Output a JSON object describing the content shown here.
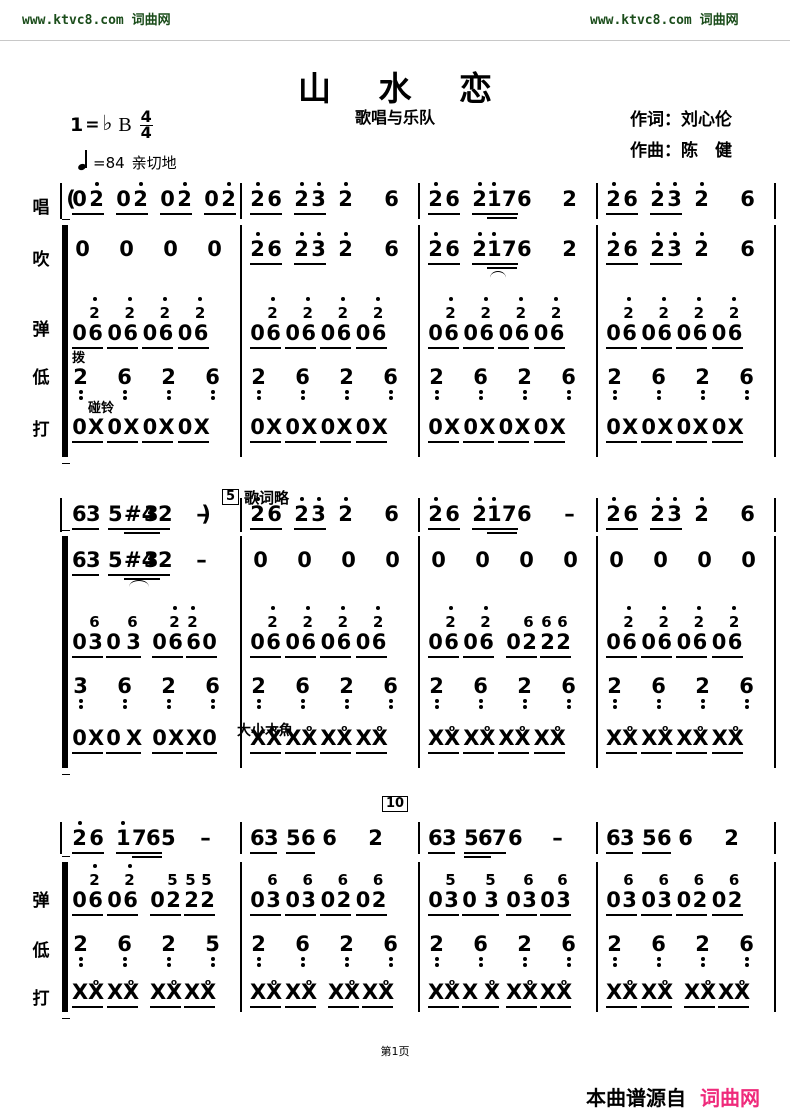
{
  "watermark": {
    "left": "www.ktvc8.com 词曲网",
    "right": "www.ktvc8.com 词曲网",
    "color": "#1b4d1b"
  },
  "header": {
    "title": "山 水 恋",
    "subtitle": "歌唱与乐队",
    "lyricist": "作词：刘心伦",
    "composer": "作曲：陈　健"
  },
  "score_meta": {
    "key_number": "1",
    "key_equals": "=",
    "key_flat": "♭",
    "key_letter": "B",
    "meter_numerator": "4",
    "meter_denominator": "4",
    "tempo_equals": "=84",
    "tempo_expression": "亲切地"
  },
  "row_labels": {
    "sing": "唱",
    "wind": "吹",
    "pluck": "弹",
    "bass": "低",
    "percussion": "打"
  },
  "annotations": {
    "bo": "拨",
    "pengling": "碰铃",
    "muyu": "大小木魚",
    "lyrics_omitted": "歌词略",
    "rehearsal_5": "5",
    "rehearsal_10": "10",
    "open_paren": "(",
    "close_paren": ")"
  },
  "footer": {
    "page": "第1页",
    "source_label": "本曲谱源自",
    "source_site": "词曲网",
    "source_color": "#ef2a7b"
  },
  "chart_data": {
    "type": "table",
    "title": "山 水 恋 — 简谱 (numbered musical notation)",
    "systems": [
      {
        "index": 1,
        "staff_rows": [
          "唱",
          "吹",
          "弹",
          "低",
          "打"
        ],
        "measures": [
          {
            "number": 1,
            "sing": "0 2̇ 0 2̇ 0 2̇ 0 2̇",
            "wind": "0  0  0  0",
            "pluck": "06 06 06 06 (upper 2̇ 2̇ 2̇ 2̇)",
            "bass": "2̣ 6̣ 2̣ 6̣",
            "percussion": "0X 0X 0X 0X"
          },
          {
            "number": 2,
            "sing": "2̇6 2̇3̇ 2̇  6",
            "wind": "2̇6 2̇3̇ 2̇  6",
            "pluck": "06 06 06 06 (upper 2̇ 2̇ 2̇ 2̇)",
            "bass": "2̣ 6̣ 2̣ 6̣",
            "percussion": "0X 0X 0X 0X"
          },
          {
            "number": 3,
            "sing": "2̇6 2̇1̇76  2",
            "wind": "2̇6 2̇1̇76  2",
            "pluck": "06 06 06 06 (upper 2̇ 2̇ 2̇ 2̇)",
            "bass": "2̣ 6̣ 2̣ 6̣",
            "percussion": "0X 0X 0X 0X"
          },
          {
            "number": 4,
            "sing": "2̇6 2̇3̇ 2̇  6",
            "wind": "2̇6 2̇3̇ 2̇  6",
            "pluck": "06 06 06 06 (upper 2̇ 2̇ 2̇ 2̇)",
            "bass": "2̣ 6̣ 2̣ 6̣",
            "percussion": "0X 0X 0X 0X"
          }
        ]
      },
      {
        "index": 2,
        "staff_rows": [
          "唱",
          "吹",
          "弹",
          "低",
          "打"
        ],
        "measures": [
          {
            "number": 5,
            "sing": "63 5 #43 2  — )",
            "wind": "63 5 #43 2  —",
            "pluck": "03 0 3 06 60 (upper 6 6 2̇ 2̇)",
            "bass": "3̣ 6̣ 2̣ 6̣",
            "percussion": "0X 0 X 0X X0"
          },
          {
            "number": 6,
            "sing": "2̇6 2̇3̇ 2̇  6",
            "wind": "0 0 0 0",
            "pluck": "06 06 06 06 (upper 2̇ 2̇ 2̇ 2̇)",
            "bass": "2̣ 6̣ 2̣ 6̣",
            "percussion": "XX XX XX XX"
          },
          {
            "number": 7,
            "sing": "2̇6 2̇1̇76  —",
            "wind": "0 0 0 0",
            "pluck": "06 06 02 22 (upper 2̇ 2̇ 6 66)",
            "bass": "2̣ 6̣ 2̣ 6̣",
            "percussion": "XX XX XX XX"
          },
          {
            "number": 8,
            "sing": "2̇6 2̇3̇ 2̇  6",
            "wind": "0 0 0 0",
            "pluck": "06 06 06 06 (upper 2̇ 2̇ 2̇ 2̇)",
            "bass": "2̣ 6̣ 2̣ 6̣",
            "percussion": "XX XX XX XX"
          }
        ]
      },
      {
        "index": 3,
        "staff_rows": [
          "弹",
          "低",
          "打"
        ],
        "measures": [
          {
            "number": 9,
            "top": "2̇6 1̇765  —",
            "pluck": "06 06 02 22 (upper 2̇ 2̇ 5 55)",
            "bass": "2̣ 6̣ 2̣ 5̣",
            "percussion": "XX XX XX XX"
          },
          {
            "number": 10,
            "top": "63 56 6   2",
            "pluck": "03 03 02 02 (upper 6 6 6 6)",
            "bass": "2̣ 6̣ 2̣ 6̣",
            "percussion": "XX XX XX XX"
          },
          {
            "number": 11,
            "top": "63 5676  —",
            "pluck": "03 0 3 03 03 (upper 5 5 6 6)",
            "bass": "2̣ 6̣ 2̣ 6̣",
            "percussion": "XX X XX XX XX"
          },
          {
            "number": 12,
            "top": "63 56 6   2",
            "pluck": "03 03 02 02 (upper 6 6 6 6)",
            "bass": "2̣ 6̣ 2̣ 6̣",
            "percussion": "XX XX XX XX"
          }
        ]
      }
    ]
  },
  "notes": {
    "s1": {
      "m1": {
        "sing": [
          "0",
          "2",
          "0",
          "2",
          "0",
          "2",
          "0",
          "2"
        ],
        "wind": [
          "0",
          "0",
          "0",
          "0"
        ],
        "pluckL": [
          "0",
          "6",
          "0",
          "6",
          "0",
          "6",
          "0",
          "6"
        ],
        "pluckU": [
          "2",
          "2",
          "2",
          "2"
        ],
        "bass": [
          "2",
          "6",
          "2",
          "6"
        ],
        "perc": [
          "0",
          "X",
          "0",
          "X",
          "0",
          "X",
          "0",
          "X"
        ]
      },
      "m2": {
        "sing": [
          "2",
          "6",
          "2",
          "3",
          "2",
          "6"
        ],
        "wind": [
          "2",
          "6",
          "2",
          "3",
          "2",
          "6"
        ],
        "pluckL": [
          "0",
          "6",
          "0",
          "6",
          "0",
          "6",
          "0",
          "6"
        ],
        "pluckU": [
          "2",
          "2",
          "2",
          "2"
        ],
        "bass": [
          "2",
          "6",
          "2",
          "6"
        ],
        "perc": [
          "0",
          "X",
          "0",
          "X",
          "0",
          "X",
          "0",
          "X"
        ]
      },
      "m3": {
        "sing": [
          "2",
          "6",
          "2",
          "1",
          "7",
          "6",
          "2"
        ],
        "wind": [
          "2",
          "6",
          "2",
          "1",
          "7",
          "6",
          "2"
        ],
        "pluckL": [
          "0",
          "6",
          "0",
          "6",
          "0",
          "6",
          "0",
          "6"
        ],
        "pluckU": [
          "2",
          "2",
          "2",
          "2"
        ],
        "bass": [
          "2",
          "6",
          "2",
          "6"
        ],
        "perc": [
          "0",
          "X",
          "0",
          "X",
          "0",
          "X",
          "0",
          "X"
        ]
      },
      "m4": {
        "sing": [
          "2",
          "6",
          "2",
          "3",
          "2",
          "6"
        ],
        "wind": [
          "2",
          "6",
          "2",
          "3",
          "2",
          "6"
        ],
        "pluckL": [
          "0",
          "6",
          "0",
          "6",
          "0",
          "6",
          "0",
          "6"
        ],
        "pluckU": [
          "2",
          "2",
          "2",
          "2"
        ],
        "bass": [
          "2",
          "6",
          "2",
          "6"
        ],
        "perc": [
          "0",
          "X",
          "0",
          "X",
          "0",
          "X",
          "0",
          "X"
        ]
      }
    },
    "s2": {
      "m5": {
        "sing": [
          "6",
          "3",
          "5",
          "#4",
          "3",
          "2",
          "–"
        ],
        "wind": [
          "6",
          "3",
          "5",
          "#4",
          "3",
          "2",
          "–"
        ],
        "pluckL": [
          "0",
          "3",
          "0",
          "3",
          "0",
          "6",
          "6",
          "0"
        ],
        "pluckU": [
          "6",
          "6",
          "2",
          "2"
        ],
        "bass": [
          "3",
          "6",
          "2",
          "6"
        ],
        "perc": [
          "0",
          "X",
          "0",
          "X",
          "0",
          "X",
          "X",
          "0"
        ]
      },
      "m6": {
        "sing": [
          "2",
          "6",
          "2",
          "3",
          "2",
          "6"
        ],
        "wind": [
          "0",
          "0",
          "0",
          "0"
        ],
        "pluckL": [
          "0",
          "6",
          "0",
          "6",
          "0",
          "6",
          "0",
          "6"
        ],
        "pluckU": [
          "2",
          "2",
          "2",
          "2"
        ],
        "bass": [
          "2",
          "6",
          "2",
          "6"
        ],
        "perc": [
          "X",
          "X",
          "X",
          "X",
          "X",
          "X",
          "X",
          "X"
        ]
      },
      "m7": {
        "sing": [
          "2",
          "6",
          "2",
          "1",
          "7",
          "6",
          "–"
        ],
        "wind": [
          "0",
          "0",
          "0",
          "0"
        ],
        "pluckL": [
          "0",
          "6",
          "0",
          "6",
          "0",
          "2",
          "2",
          "2"
        ],
        "pluckU": [
          "2",
          "2",
          "6",
          "6",
          "6"
        ],
        "bass": [
          "2",
          "6",
          "2",
          "6"
        ],
        "perc": [
          "X",
          "X",
          "X",
          "X",
          "X",
          "X",
          "X",
          "X"
        ]
      },
      "m8": {
        "sing": [
          "2",
          "6",
          "2",
          "3",
          "2",
          "6"
        ],
        "wind": [
          "0",
          "0",
          "0",
          "0"
        ],
        "pluckL": [
          "0",
          "6",
          "0",
          "6",
          "0",
          "6",
          "0",
          "6"
        ],
        "pluckU": [
          "2",
          "2",
          "2",
          "2"
        ],
        "bass": [
          "2",
          "6",
          "2",
          "6"
        ],
        "perc": [
          "X",
          "X",
          "X",
          "X",
          "X",
          "X",
          "X",
          "X"
        ]
      }
    },
    "s3": {
      "m9": {
        "top": [
          "2",
          "6",
          "1",
          "7",
          "6",
          "5",
          "–"
        ],
        "pluckL": [
          "0",
          "6",
          "0",
          "6",
          "0",
          "2",
          "2",
          "2"
        ],
        "pluckU": [
          "2",
          "2",
          "5",
          "5",
          "5"
        ],
        "bass": [
          "2",
          "6",
          "2",
          "5"
        ],
        "perc": [
          "X",
          "X",
          "X",
          "X",
          "X",
          "X",
          "X",
          "X"
        ]
      },
      "m10": {
        "top": [
          "6",
          "3",
          "5",
          "6",
          "6",
          "2"
        ],
        "pluckL": [
          "0",
          "3",
          "0",
          "3",
          "0",
          "2",
          "0",
          "2"
        ],
        "pluckU": [
          "6",
          "6",
          "6",
          "6"
        ],
        "bass": [
          "2",
          "6",
          "2",
          "6"
        ],
        "perc": [
          "X",
          "X",
          "X",
          "X",
          "X",
          "X",
          "X",
          "X"
        ]
      },
      "m11": {
        "top": [
          "6",
          "3",
          "5",
          "6",
          "7",
          "6",
          "–"
        ],
        "pluckL": [
          "0",
          "3",
          "0",
          "3",
          "0",
          "3",
          "0",
          "3"
        ],
        "pluckU": [
          "5",
          "5",
          "6",
          "6"
        ],
        "bass": [
          "2",
          "6",
          "2",
          "6"
        ],
        "perc": [
          "X",
          "X",
          "X",
          "X",
          "X",
          "X",
          "X",
          "X"
        ]
      },
      "m12": {
        "top": [
          "6",
          "3",
          "5",
          "6",
          "6",
          "2"
        ],
        "pluckL": [
          "0",
          "3",
          "0",
          "3",
          "0",
          "2",
          "0",
          "2"
        ],
        "pluckU": [
          "6",
          "6",
          "6",
          "6"
        ],
        "bass": [
          "2",
          "6",
          "2",
          "6"
        ],
        "perc": [
          "X",
          "X",
          "X",
          "X",
          "X",
          "X",
          "X",
          "X"
        ]
      }
    }
  }
}
